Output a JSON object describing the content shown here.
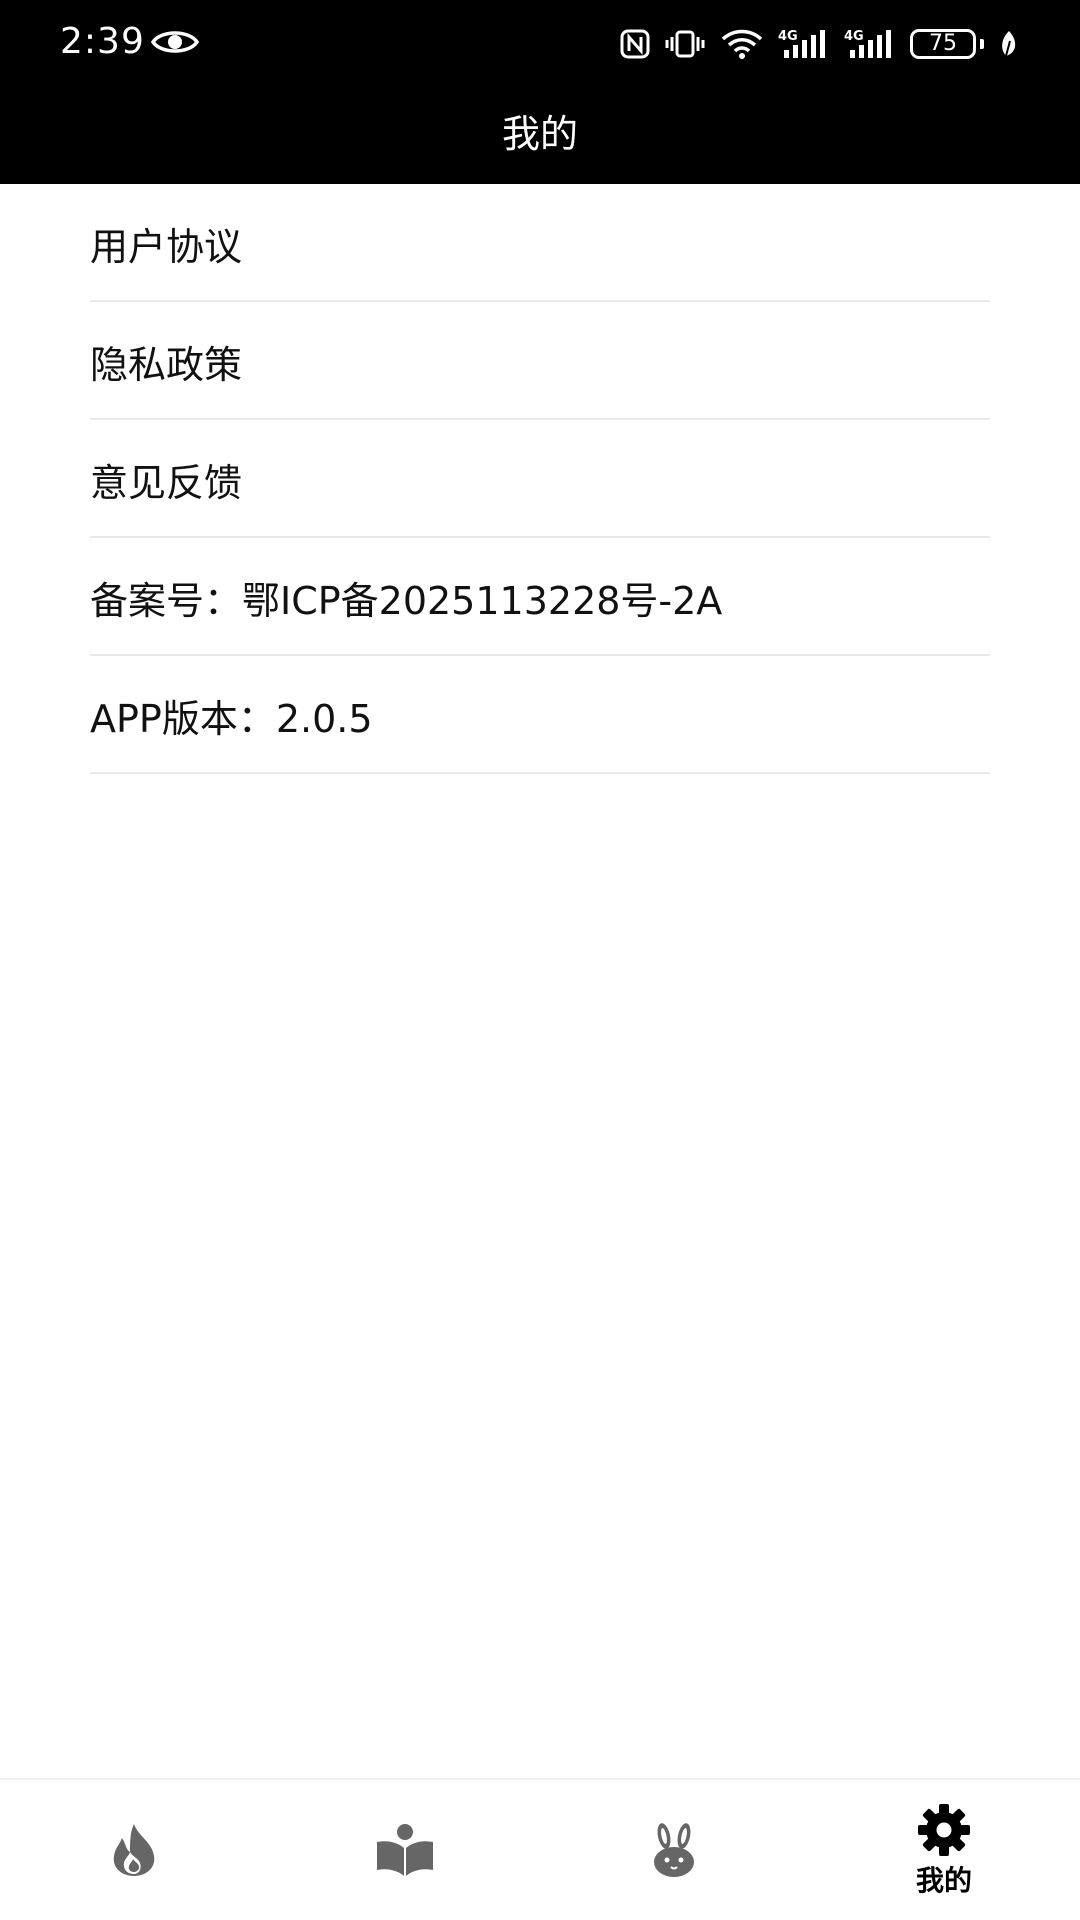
{
  "status_bar": {
    "time": "2:39",
    "battery_level": "75",
    "network_1": "4G",
    "network_2": "4G",
    "icons": [
      "eye-icon",
      "nfc-icon",
      "vibrate-icon",
      "wifi-icon",
      "signal-icon",
      "signal-icon",
      "battery-icon",
      "leaf-icon"
    ]
  },
  "header": {
    "title": "我的"
  },
  "menu": {
    "items": [
      {
        "label": "用户协议"
      },
      {
        "label": "隐私政策"
      },
      {
        "label": "意见反馈"
      },
      {
        "label": "备案号：鄂ICP备2025113228号-2A"
      },
      {
        "label": "APP版本：2.0.5"
      }
    ]
  },
  "bottom_nav": {
    "tabs": [
      {
        "icon": "fire-icon",
        "label": ""
      },
      {
        "icon": "reading-icon",
        "label": ""
      },
      {
        "icon": "rabbit-icon",
        "label": ""
      },
      {
        "icon": "gear-icon",
        "label": "我的",
        "active": true
      }
    ]
  },
  "colors": {
    "header_background": "#000000",
    "header_text": "#ffffff",
    "divider": "#e8e8e8",
    "inactive_icon": "#666666",
    "active_icon": "#000000"
  }
}
